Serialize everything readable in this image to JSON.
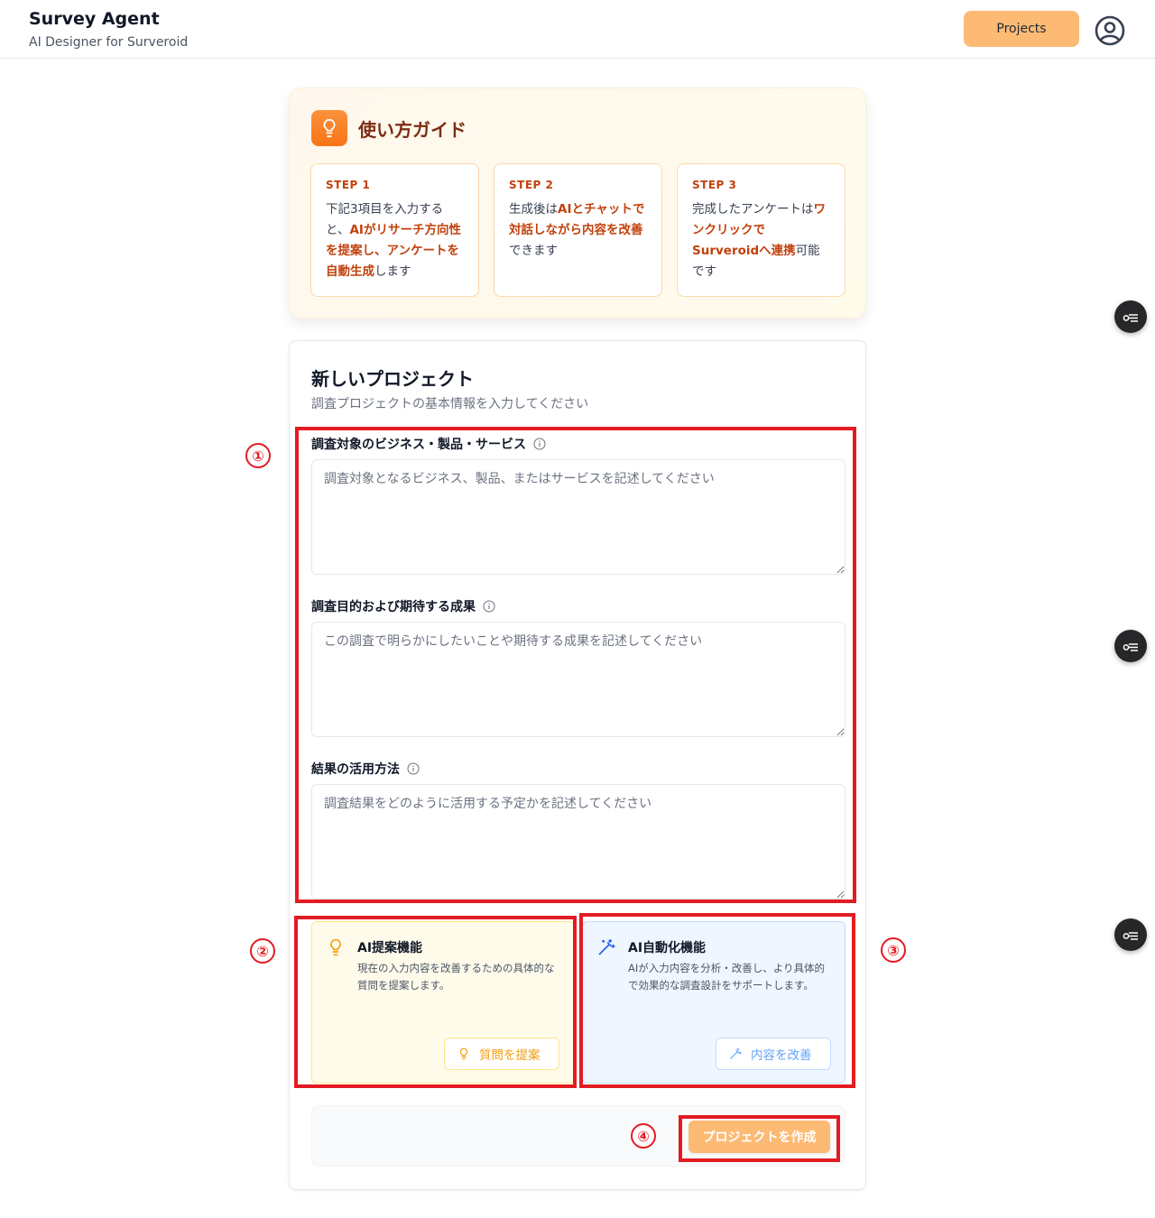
{
  "header": {
    "title": "Survey Agent",
    "subtitle": "AI Designer for Surveroid",
    "projects_label": "Projects"
  },
  "guide": {
    "title": "使い方ガイド",
    "steps": [
      {
        "label": "STEP 1",
        "segments": [
          {
            "t": "下記3項目を入力すると、",
            "b": false
          },
          {
            "t": "AIがリサーチ方向性を提案し、アンケートを自動生成",
            "b": true
          },
          {
            "t": "します",
            "b": false
          }
        ]
      },
      {
        "label": "STEP 2",
        "segments": [
          {
            "t": "生成後は",
            "b": false
          },
          {
            "t": "AIとチャットで対話しながら内容を改善",
            "b": true
          },
          {
            "t": "できます",
            "b": false
          }
        ]
      },
      {
        "label": "STEP 3",
        "segments": [
          {
            "t": "完成したアンケートは",
            "b": false
          },
          {
            "t": "ワンクリックでSurveroidへ連携",
            "b": true
          },
          {
            "t": "可能です",
            "b": false
          }
        ]
      }
    ]
  },
  "form": {
    "title": "新しいプロジェクト",
    "subtitle": "調査プロジェクトの基本情報を入力してください",
    "fields": [
      {
        "label": "調査対象のビジネス・製品・サービス",
        "placeholder": "調査対象となるビジネス、製品、またはサービスを記述してください",
        "value": ""
      },
      {
        "label": "調査目的および期待する成果",
        "placeholder": "この調査で明らかにしたいことや期待する成果を記述してください",
        "value": ""
      },
      {
        "label": "結果の活用方法",
        "placeholder": "調査結果をどのように活用する予定かを記述してください",
        "value": ""
      }
    ],
    "ai_suggest": {
      "title": "AI提案機能",
      "description": "現在の入力内容を改善するための具体的な質問を提案します。",
      "button": "質問を提案"
    },
    "ai_auto": {
      "title": "AI自動化機能",
      "description": "AIが入力内容を分析・改善し、より具体的で効果的な調査設計をサポートします。",
      "button": "内容を改善"
    },
    "create_button": "プロジェクトを作成"
  },
  "annotations": [
    "①",
    "②",
    "③",
    "④"
  ],
  "colors": {
    "accent": "#fdba74",
    "guide_text": "#c2410c",
    "annotation": "#e31b23",
    "suggest": "#f59e0b",
    "improve": "#60a5fa"
  },
  "icons": {
    "user": "user-circle-icon",
    "guide": "lightbulb-icon",
    "info": "info-icon",
    "suggest": "lightbulb-icon",
    "improve": "magic-wand-icon",
    "float": "key-list-icon"
  }
}
